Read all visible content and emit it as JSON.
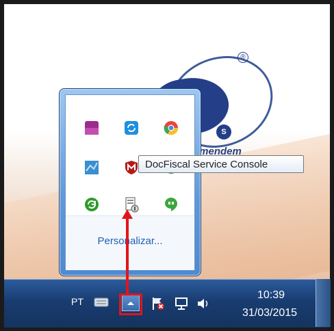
{
  "desktop": {
    "logo_letter": "S",
    "logo_registered": "®",
    "logo_tagline": "omendem"
  },
  "tray_popup": {
    "icons": [
      {
        "name": "purple-app-icon",
        "color": "#9a2d8b"
      },
      {
        "name": "blue-sync-icon",
        "color": "#1f8fdd"
      },
      {
        "name": "chrome-icon",
        "color": "#e8453c"
      },
      {
        "name": "network-map-icon",
        "color": "#3b8fd0"
      },
      {
        "name": "mcafee-shield-icon",
        "color": "#b31b1b"
      },
      {
        "name": "green-app-icon",
        "color": "#3c9a2d"
      },
      {
        "name": "green-refresh-icon",
        "color": "#2e9b2a"
      },
      {
        "name": "docfiscal-service-icon",
        "color": "#7a7a7a"
      },
      {
        "name": "hangouts-icon",
        "color": "#3ca63c"
      }
    ],
    "personalize_label": "Personalizar..."
  },
  "tooltip": {
    "text": "DocFiscal Service Console"
  },
  "taskbar": {
    "language": "PT",
    "time": "10:39",
    "date": "31/03/2015"
  },
  "colors": {
    "highlight": "#e0161b",
    "taskbar": "#1b3f73",
    "link": "#1e5fb6"
  }
}
